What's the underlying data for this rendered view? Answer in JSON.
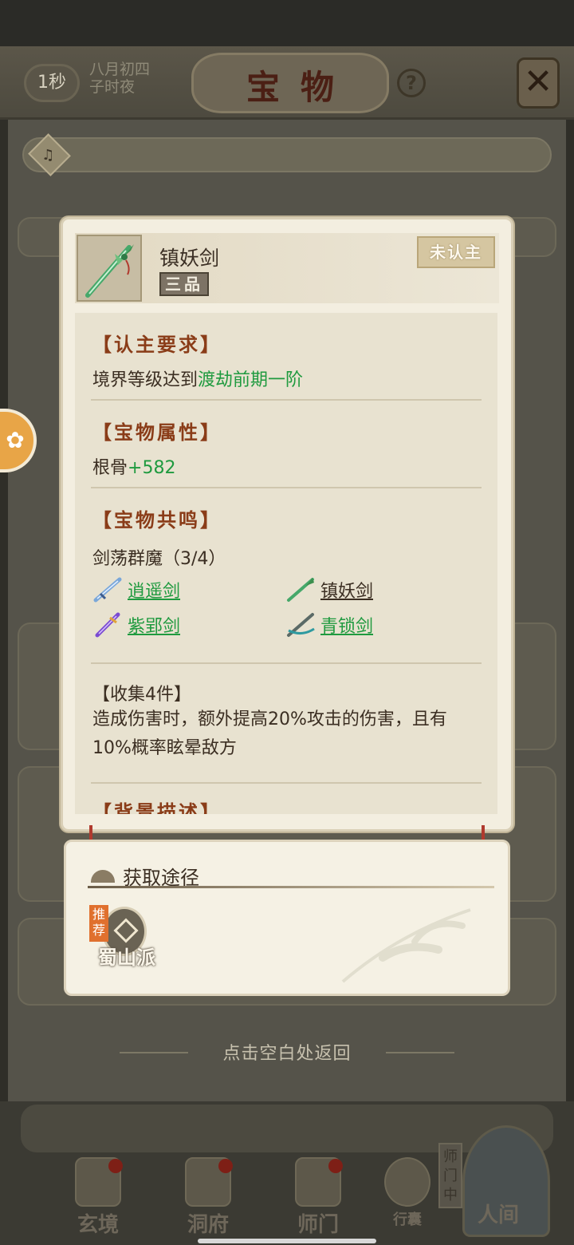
{
  "header": {
    "timer": "1秒",
    "date_line1": "八月初四",
    "date_line2": "子时夜",
    "title": "宝物",
    "help_label": "?",
    "close_icon": "close-crossed-icon"
  },
  "item": {
    "name": "镇妖剑",
    "grade": "三品",
    "status": "未认主",
    "icon": "green-sword-icon"
  },
  "requirement": {
    "title": "【认主要求】",
    "prefix": "境界等级达到",
    "value": "渡劫前期一阶"
  },
  "attributes": {
    "title": "【宝物属性】",
    "stat_name": "根骨",
    "stat_value": "+582"
  },
  "resonance": {
    "title": "【宝物共鸣】",
    "set_name": "剑荡群魔（3/4）",
    "items": [
      {
        "name": "逍遥剑",
        "owned": true,
        "icon": "blue-sword-icon"
      },
      {
        "name": "镇妖剑",
        "owned": false,
        "icon": "green-sword-icon"
      },
      {
        "name": "紫郢剑",
        "owned": true,
        "icon": "purple-sword-icon"
      },
      {
        "name": "青锁剑",
        "owned": true,
        "icon": "teal-sword-icon"
      }
    ],
    "bonus_title": "【收集4件】",
    "bonus_text": "造成伤害时，额外提高20%攻击的伤害，且有10%概率眩晕敌方"
  },
  "background": {
    "title": "【背景描述】"
  },
  "source": {
    "title": "获取途径",
    "recommend_tag": "推荐",
    "sect_name": "蜀山派"
  },
  "back_hint": "点击空白处返回",
  "bottom_nav": [
    {
      "label": "玄境",
      "has_dot": true
    },
    {
      "label": "洞府",
      "has_dot": true
    },
    {
      "label": "师门",
      "has_dot": true
    },
    {
      "label": "行囊",
      "has_dot": false
    },
    {
      "label": "人间",
      "has_dot": true
    }
  ],
  "shimen_tag": "师门中",
  "colors": {
    "accent_green": "#1f9a3f",
    "section_title": "#8a3c18",
    "popup_bg": "#f3eee0"
  }
}
